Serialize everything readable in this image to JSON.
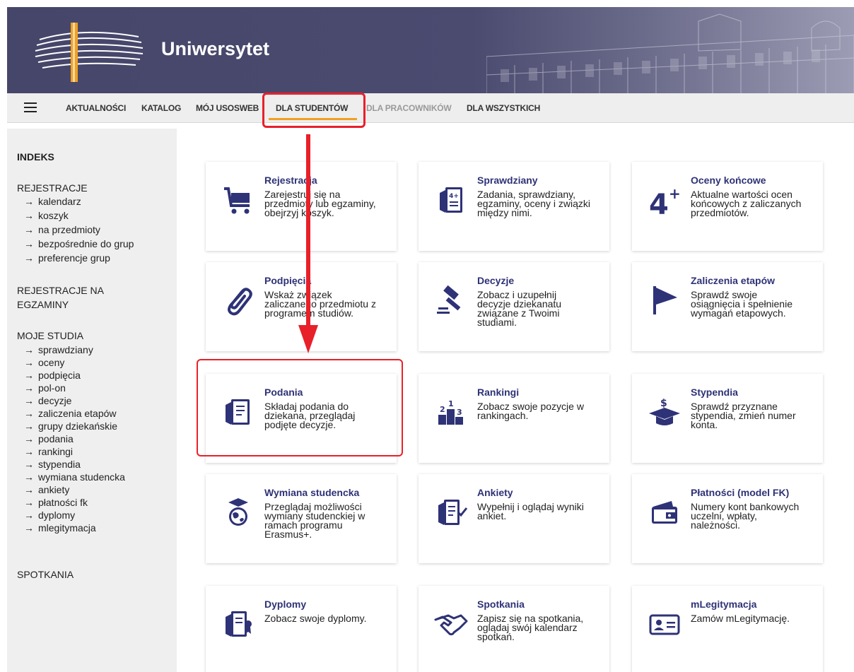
{
  "header": {
    "title": "Uniwersytet"
  },
  "nav": {
    "items": [
      {
        "label": "AKTUALNOŚCI"
      },
      {
        "label": "KATALOG"
      },
      {
        "label": "MÓJ USOSWEB"
      },
      {
        "label": "DLA STUDENTÓW"
      },
      {
        "label": "DLA PRACOWNIKÓW"
      },
      {
        "label": "DLA WSZYSTKICH"
      }
    ]
  },
  "sidebar": {
    "indeks": "INDEKS",
    "rejestracje": "REJESTRACJE",
    "rejestracje_links": [
      "kalendarz",
      "koszyk",
      "na przedmioty",
      "bezpośrednie do grup",
      "preferencje grup"
    ],
    "rejestracje_egz_1": "REJESTRACJE NA",
    "rejestracje_egz_2": "EGZAMINY",
    "moje_studia": "MOJE STUDIA",
    "moje_studia_links": [
      "sprawdziany",
      "oceny",
      "podpięcia",
      "pol-on",
      "decyzje",
      "zaliczenia etapów",
      "grupy dziekańskie",
      "podania",
      "rankingi",
      "stypendia",
      "wymiana studencka",
      "ankiety",
      "płatności fk",
      "dyplomy",
      "mlegitymacja"
    ],
    "spotkania": "SPOTKANIA",
    "arrow": "→"
  },
  "cards": [
    {
      "icon": "shopping-cart-icon",
      "title": "Rejestracja",
      "lines": [
        "Zarejestruj się na",
        "przedmioty lub egzaminy,",
        "obejrzyj koszyk."
      ]
    },
    {
      "icon": "test-sheet-icon",
      "title": "Sprawdziany",
      "lines": [
        "Zadania, sprawdziany,",
        "egzaminy, oceny i związki",
        "między nimi."
      ]
    },
    {
      "icon": "grade-four-plus-icon",
      "title": "Oceny końcowe",
      "lines": [
        "Aktualne wartości ocen",
        "końcowych z zaliczanych",
        "przedmiotów."
      ]
    },
    {
      "icon": "paperclip-icon",
      "title": "Podpięcia",
      "lines": [
        "Wskaż związek",
        "zaliczanego przedmiotu z",
        "programem studiów."
      ]
    },
    {
      "icon": "gavel-icon",
      "title": "Decyzje",
      "lines": [
        "Zobacz i uzupełnij",
        "decyzje dziekanatu",
        "związane z Twoimi",
        "studiami."
      ]
    },
    {
      "icon": "flag-icon",
      "title": "Zaliczenia etapów",
      "lines": [
        "Sprawdź swoje",
        "osiągnięcia i spełnienie",
        "wymagań etapowych."
      ]
    },
    {
      "icon": "document-icon",
      "title": "Podania",
      "lines": [
        "Składaj podania do",
        "dziekana, przeglądaj",
        "podjęte decyzje."
      ]
    },
    {
      "icon": "podium-icon",
      "title": "Rankingi",
      "lines": [
        "Zobacz swoje pozycje w",
        "rankingach."
      ]
    },
    {
      "icon": "scholarship-cap-icon",
      "title": "Stypendia",
      "lines": [
        "Sprawdź przyznane",
        "stypendia, zmień numer",
        "konta."
      ]
    },
    {
      "icon": "globe-cap-icon",
      "title": "Wymiana studencka",
      "lines": [
        "Przeglądaj możliwości",
        "wymiany studenckiej w",
        "ramach programu",
        "Erasmus+."
      ]
    },
    {
      "icon": "survey-icon",
      "title": "Ankiety",
      "lines": [
        "Wypełnij i oglądaj wyniki",
        "ankiet."
      ]
    },
    {
      "icon": "wallet-icon",
      "title": "Płatności (model FK)",
      "lines": [
        "Numery kont bankowych",
        "uczelni, wpłaty,",
        "należności."
      ]
    },
    {
      "icon": "diploma-icon",
      "title": "Dyplomy",
      "lines": [
        "Zobacz swoje dyplomy."
      ]
    },
    {
      "icon": "handshake-icon",
      "title": "Spotkania",
      "lines": [
        "Zapisz się na spotkania,",
        "oglądaj swój kalendarz",
        "spotkań."
      ]
    },
    {
      "icon": "id-card-icon",
      "title": "mLegitymacja",
      "lines": [
        "Zamów mLegitymację."
      ]
    }
  ],
  "icon_glyphs": {
    "sheet_mark": "4+",
    "grade": "4",
    "grade_plus": "+",
    "rank_2": "2",
    "rank_1": "1",
    "rank_3": "3",
    "dollar": "$"
  },
  "colors": {
    "accent": "#2e3276",
    "nav_active": "#f0a020",
    "annotation": "#e8202a",
    "banner": "#4b4b70"
  }
}
